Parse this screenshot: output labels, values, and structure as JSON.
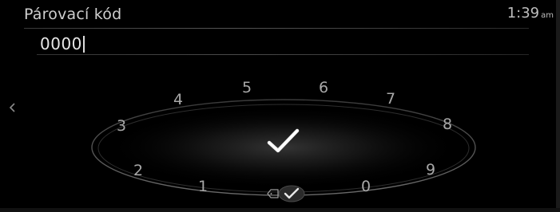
{
  "header": {
    "title": "Párovací kód",
    "clock_time": "1:39",
    "clock_ampm": "am"
  },
  "input": {
    "value": "0000"
  },
  "dial": {
    "digits": [
      "5",
      "6",
      "4",
      "7",
      "3",
      "8",
      "2",
      "9",
      "1",
      "0"
    ]
  },
  "icons": {
    "back": "chevron-left-icon",
    "confirm": "checkmark-icon",
    "delete": "backspace-icon",
    "confirm_small": "checkmark-icon"
  },
  "colors": {
    "background": "#000000",
    "text": "#cfcfcf",
    "digit": "#a8a8a8",
    "ring": "#5a5a5a"
  }
}
